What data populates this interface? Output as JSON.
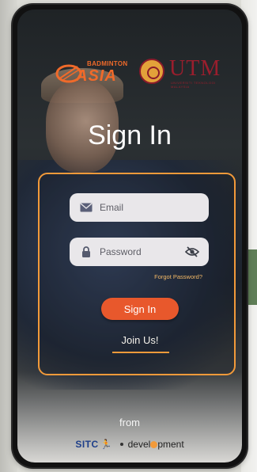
{
  "app": {
    "title": "Sign In",
    "brand_left_top": "BADMINTON",
    "brand_left_main": "ASIA",
    "brand_right": "UTM",
    "brand_right_sub": "UNIVERSITI TEKNOLOGI MALAYSIA"
  },
  "form": {
    "email_placeholder": "Email",
    "email_value": "",
    "password_placeholder": "Password",
    "password_value": "",
    "forgot_label": "Forgot Password?",
    "signin_label": "Sign In",
    "join_label": "Join Us!"
  },
  "footer": {
    "from_label": "from",
    "sponsor_1": "SITC",
    "sponsor_2_a": "devel",
    "sponsor_2_b": "pment"
  },
  "icons": {
    "email": "envelope-icon",
    "password": "lock-icon",
    "visibility": "eye-off-icon"
  },
  "colors": {
    "accent": "#f29a3a",
    "button": "#e8582c",
    "utm_red": "#9a1e2d"
  }
}
